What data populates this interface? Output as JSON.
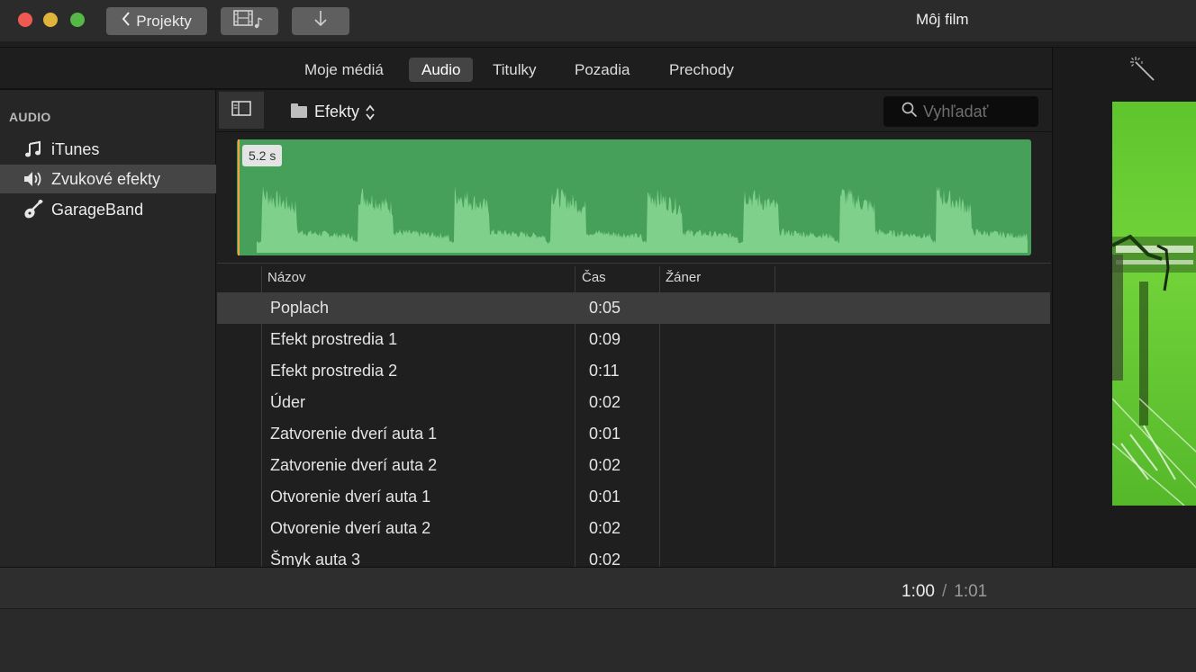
{
  "titlebar": {
    "projects_label": "Projekty",
    "window_title": "Môj film"
  },
  "tabs": [
    {
      "label": "Moje médiá",
      "active": false
    },
    {
      "label": "Audio",
      "active": true
    },
    {
      "label": "Titulky",
      "active": false
    },
    {
      "label": "Pozadia",
      "active": false
    },
    {
      "label": "Prechody",
      "active": false
    }
  ],
  "sidebar": {
    "header": "AUDIO",
    "items": [
      {
        "label": "iTunes",
        "icon": "music-note-icon",
        "selected": false
      },
      {
        "label": "Zvukové efekty",
        "icon": "speaker-icon",
        "selected": true
      },
      {
        "label": "GarageBand",
        "icon": "guitar-icon",
        "selected": false
      }
    ]
  },
  "browser": {
    "folder_label": "Efekty",
    "search_placeholder": "Vyhľadať",
    "clip_duration": "5.2 s",
    "columns": {
      "name": "Názov",
      "time": "Čas",
      "genre": "Žáner"
    },
    "rows": [
      {
        "name": "Poplach",
        "time": "0:05",
        "selected": true
      },
      {
        "name": "Efekt prostredia 1",
        "time": "0:09",
        "selected": false
      },
      {
        "name": "Efekt prostredia 2",
        "time": "0:11",
        "selected": false
      },
      {
        "name": "Úder",
        "time": "0:02",
        "selected": false
      },
      {
        "name": "Zatvorenie dverí auta 1",
        "time": "0:01",
        "selected": false
      },
      {
        "name": "Zatvorenie dverí auta 2",
        "time": "0:02",
        "selected": false
      },
      {
        "name": "Otvorenie dverí auta 1",
        "time": "0:01",
        "selected": false
      },
      {
        "name": "Otvorenie dverí auta 2",
        "time": "0:02",
        "selected": false
      },
      {
        "name": "Šmyk auta 3",
        "time": "0:02",
        "selected": false
      }
    ]
  },
  "timecode": {
    "current": "1:00",
    "separator": "/",
    "total": "1:01"
  },
  "colors": {
    "waveform": "#47a05a",
    "waveform_peak": "#7fd08a",
    "playhead": "#f2a23c"
  }
}
